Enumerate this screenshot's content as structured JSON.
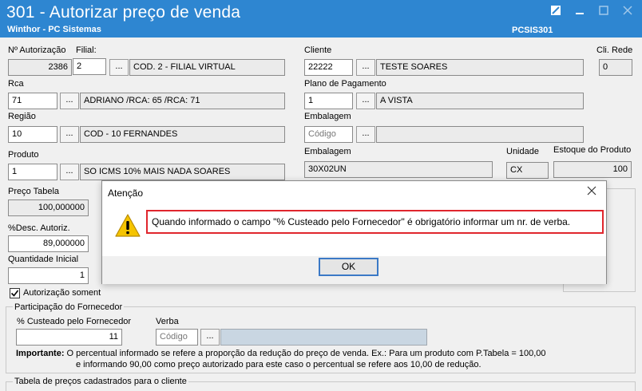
{
  "window": {
    "title": "301 - Autorizar preço de venda",
    "subtitle": "Winthor - PC Sistemas",
    "code": "PCSIS301",
    "restore_icon": "restore-icon",
    "minimize_icon": "minimize-icon",
    "maximize_icon": "maximize-icon",
    "close_icon": "close-icon"
  },
  "form": {
    "autorizacao_label": "Nº Autorização",
    "autorizacao_value": "2386",
    "filial_label": "Filial:",
    "filial_value": "2",
    "filial_desc": "COD. 2 - FILIAL VIRTUAL",
    "cliente_label": "Cliente",
    "cliente_value": "22222",
    "cliente_desc": "TESTE SOARES",
    "cli_rede_label": "Cli. Rede",
    "cli_rede_value": "0",
    "rca_label": "Rca",
    "rca_value": "71",
    "rca_desc": "ADRIANO /RCA: 65 /RCA: 71",
    "plano_label": "Plano de Pagamento",
    "plano_value": "1",
    "plano_desc": "A VISTA",
    "regiao_label": "Região",
    "regiao_value": "10",
    "regiao_desc": "COD - 10 FERNANDES",
    "embalagem_label": "Embalagem",
    "embalagem_placeholder": "Código",
    "produto_label": "Produto",
    "produto_value": "1",
    "produto_desc": "SO ICMS 10% MAIS NADA SOARES",
    "embalagem2_label": "Embalagem",
    "embalagem2_value": "30X02UN",
    "unidade_label": "Unidade",
    "unidade_value": "CX",
    "estoque_label": "Estoque do Produto",
    "estoque_value": "100",
    "preco_tabela_label": "Preço Tabela",
    "preco_tabela_value": "100,000000",
    "desc_label": "%Desc. Autoriz.",
    "desc_value": "89,000000",
    "qtd_label": "Quantidade Inicial",
    "qtd_value": "1",
    "autorizacao_somente_label": "Autorização soment",
    "participacao_label": "Participação do Fornecedor",
    "custeado_label": "% Custeado pelo Fornecedor",
    "custeado_value": "11",
    "verba_label": "Verba",
    "verba_placeholder": "Código",
    "dots_label": "...",
    "importante_bold": "Importante:",
    "importante_line1": " O percentual informado se refere a proporção da redução do preço de venda. Ex.: Para um produto com P.Tabela = 100,00",
    "importante_line2": "e informando 90,00 como preço autorizado para este caso o percentual se refere aos 10,00 de redução.",
    "tabela_label": "Tabela de preços cadastrados para o cliente"
  },
  "dialog": {
    "title": "Atenção",
    "message": "Quando informado o campo \"% Custeado pelo Fornecedor\" é obrigatório informar um nr. de verba.",
    "ok_label": "OK"
  },
  "colors": {
    "titlebar": "#2e86d1",
    "highlight": "#e0262d",
    "ok_border": "#3b79c6"
  }
}
